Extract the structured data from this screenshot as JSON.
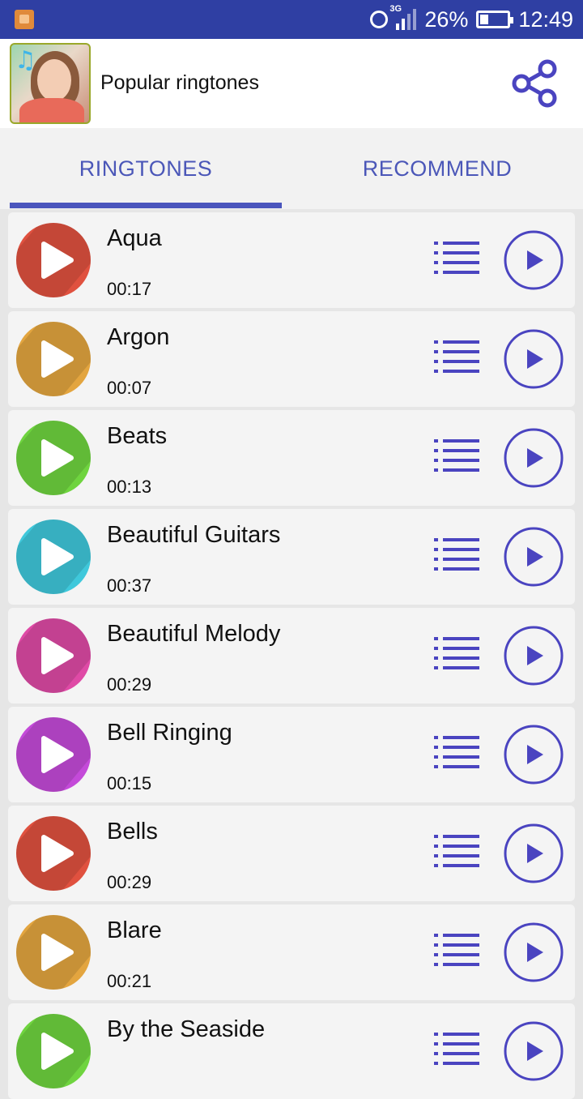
{
  "status": {
    "network": "3G",
    "battery": "26%",
    "time": "12:49"
  },
  "header": {
    "title": "Popular ringtones"
  },
  "tabs": [
    {
      "label": "RINGTONES",
      "selected": true
    },
    {
      "label": "RECOMMEND",
      "selected": false
    }
  ],
  "ringtones": [
    {
      "title": "Aqua",
      "duration": "00:17",
      "color": "#e0513f"
    },
    {
      "title": "Argon",
      "duration": "00:07",
      "color": "#e3a53f"
    },
    {
      "title": "Beats",
      "duration": "00:13",
      "color": "#6fd43f"
    },
    {
      "title": "Beautiful Guitars",
      "duration": "00:37",
      "color": "#3fc8db"
    },
    {
      "title": "Beautiful Melody",
      "duration": "00:29",
      "color": "#df4aa6"
    },
    {
      "title": "Bell Ringing",
      "duration": "00:15",
      "color": "#c44ad9"
    },
    {
      "title": "Bells",
      "duration": "00:29",
      "color": "#e0513f"
    },
    {
      "title": "Blare",
      "duration": "00:21",
      "color": "#e3a53f"
    },
    {
      "title": "By the Seaside",
      "duration": "",
      "color": "#6fd43f"
    }
  ],
  "colors": {
    "accent": "#4a55bd",
    "statusbar": "#2f3fa3"
  },
  "icons": {
    "share": "share-icon",
    "list": "list-icon",
    "play": "play-circle-icon"
  }
}
